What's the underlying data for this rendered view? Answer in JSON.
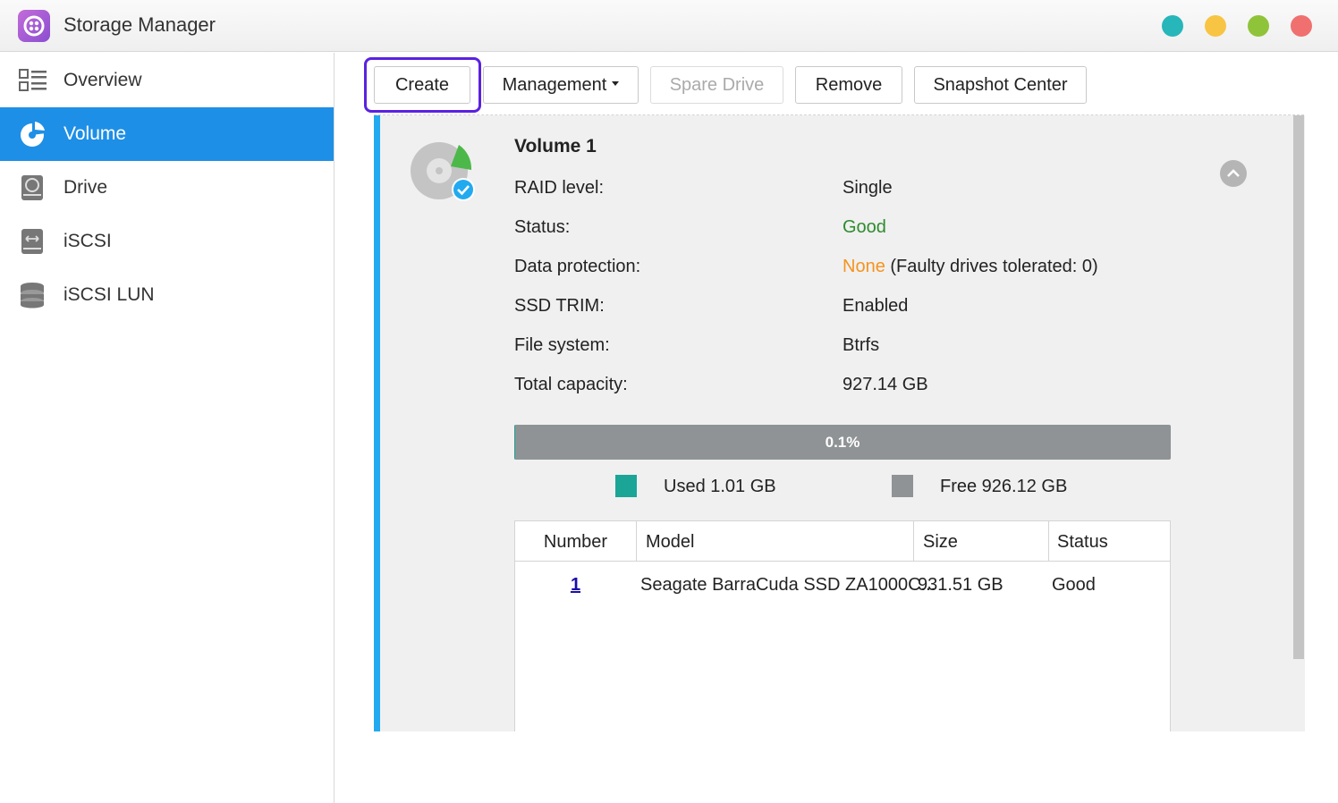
{
  "window": {
    "title": "Storage Manager",
    "controls": [
      {
        "name": "teal",
        "color": "#27b6b9"
      },
      {
        "name": "yellow",
        "color": "#f7c543"
      },
      {
        "name": "green",
        "color": "#8fc43a"
      },
      {
        "name": "red",
        "color": "#f07070"
      }
    ]
  },
  "sidebar": {
    "items": [
      {
        "label": "Overview",
        "icon": "overview-icon",
        "active": false
      },
      {
        "label": "Volume",
        "icon": "volume-icon",
        "active": true
      },
      {
        "label": "Drive",
        "icon": "drive-icon",
        "active": false
      },
      {
        "label": "iSCSI",
        "icon": "iscsi-icon",
        "active": false
      },
      {
        "label": "iSCSI LUN",
        "icon": "iscsi-lun-icon",
        "active": false
      }
    ]
  },
  "toolbar": {
    "create": "Create",
    "management": "Management",
    "spare_drive": "Spare Drive",
    "remove": "Remove",
    "snapshot_center": "Snapshot Center"
  },
  "volume": {
    "name": "Volume 1",
    "properties": {
      "raid_label": "RAID level:",
      "raid_value": "Single",
      "status_label": "Status:",
      "status_value": "Good",
      "protection_label": "Data protection:",
      "protection_value": "None",
      "protection_note": " (Faulty drives tolerated: 0)",
      "trim_label": "SSD TRIM:",
      "trim_value": "Enabled",
      "fs_label": "File system:",
      "fs_value": "Btrfs",
      "capacity_label": "Total capacity:",
      "capacity_value": "927.14 GB"
    },
    "usage": {
      "percent_text": "0.1%",
      "used_fraction": 0.001,
      "used_label": "Used 1.01 GB",
      "free_label": "Free 926.12 GB",
      "used_color": "#1ba597",
      "free_color": "#8f9395"
    },
    "drives": {
      "headers": {
        "number": "Number",
        "model": "Model",
        "size": "Size",
        "status": "Status"
      },
      "rows": [
        {
          "number": "1",
          "model": "Seagate BarraCuda SSD ZA1000C...",
          "size": "931.51 GB",
          "status": "Good"
        }
      ]
    }
  }
}
